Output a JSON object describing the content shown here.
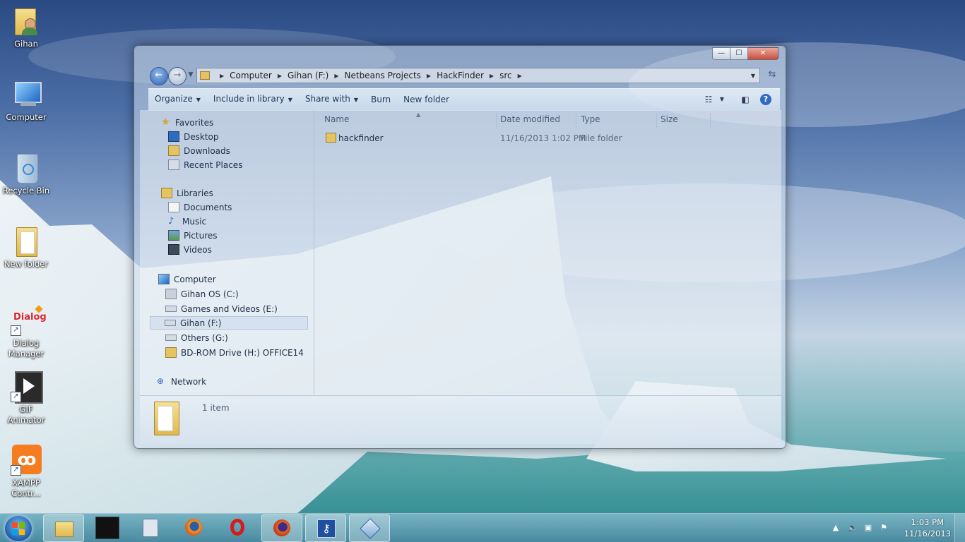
{
  "desktop": {
    "icons": [
      {
        "label": "Gihan",
        "icon": "user-folder-icon"
      },
      {
        "label": "Computer",
        "icon": "computer-icon"
      },
      {
        "label": "Recycle Bin",
        "icon": "recycle-bin-icon"
      },
      {
        "label": "New folder",
        "icon": "folder-icon"
      },
      {
        "label": "Dialog\nManager",
        "icon": "dialog-app-icon"
      },
      {
        "label": "GIF Animator",
        "icon": "gif-animator-icon"
      },
      {
        "label": "XAMPP\nContr...",
        "icon": "xampp-icon"
      }
    ]
  },
  "explorer": {
    "caption_buttons": {
      "minimize": "—",
      "maximize": "☐",
      "close": "✕"
    },
    "breadcrumb": [
      "Computer",
      "Gihan (F:)",
      "Netbeans Projects",
      "HackFinder",
      "src"
    ],
    "toolbar": {
      "organize": "Organize",
      "include_in_library": "Include in library",
      "share_with": "Share with",
      "burn": "Burn",
      "new_folder": "New folder"
    },
    "nav": {
      "favorites": {
        "title": "Favorites",
        "items": [
          "Desktop",
          "Downloads",
          "Recent Places"
        ]
      },
      "libraries": {
        "title": "Libraries",
        "items": [
          "Documents",
          "Music",
          "Pictures",
          "Videos"
        ]
      },
      "computer": {
        "title": "Computer",
        "items": [
          "Gihan OS (C:)",
          "Games and Videos (E:)",
          "Gihan (F:)",
          "Others (G:)",
          "BD-ROM Drive (H:) OFFICE14"
        ],
        "selected": "Gihan (F:)"
      },
      "network": {
        "title": "Network"
      }
    },
    "columns": {
      "name": "Name",
      "date_modified": "Date modified",
      "type": "Type",
      "size": "Size"
    },
    "files": [
      {
        "name": "hackfinder",
        "date_modified": "11/16/2013 1:02 PM",
        "type": "File folder",
        "size": ""
      }
    ],
    "details": {
      "count": "1 item"
    }
  },
  "taskbar": {
    "apps": [
      "Windows Explorer",
      "Ojuththara Madhura",
      "Calculator",
      "Firefox",
      "Opera",
      "Firefox Nightly",
      "Password Manager",
      "VirtualBox"
    ],
    "clock": {
      "time": "1:03 PM",
      "date": "11/16/2013"
    },
    "tray": [
      "show-hidden-icon",
      "volume-icon",
      "network-icon",
      "action-center-icon"
    ]
  },
  "colors": {
    "taskbar": "#5a9ab5",
    "window_frame": "#cddceb",
    "link_text": "#1e395b"
  }
}
